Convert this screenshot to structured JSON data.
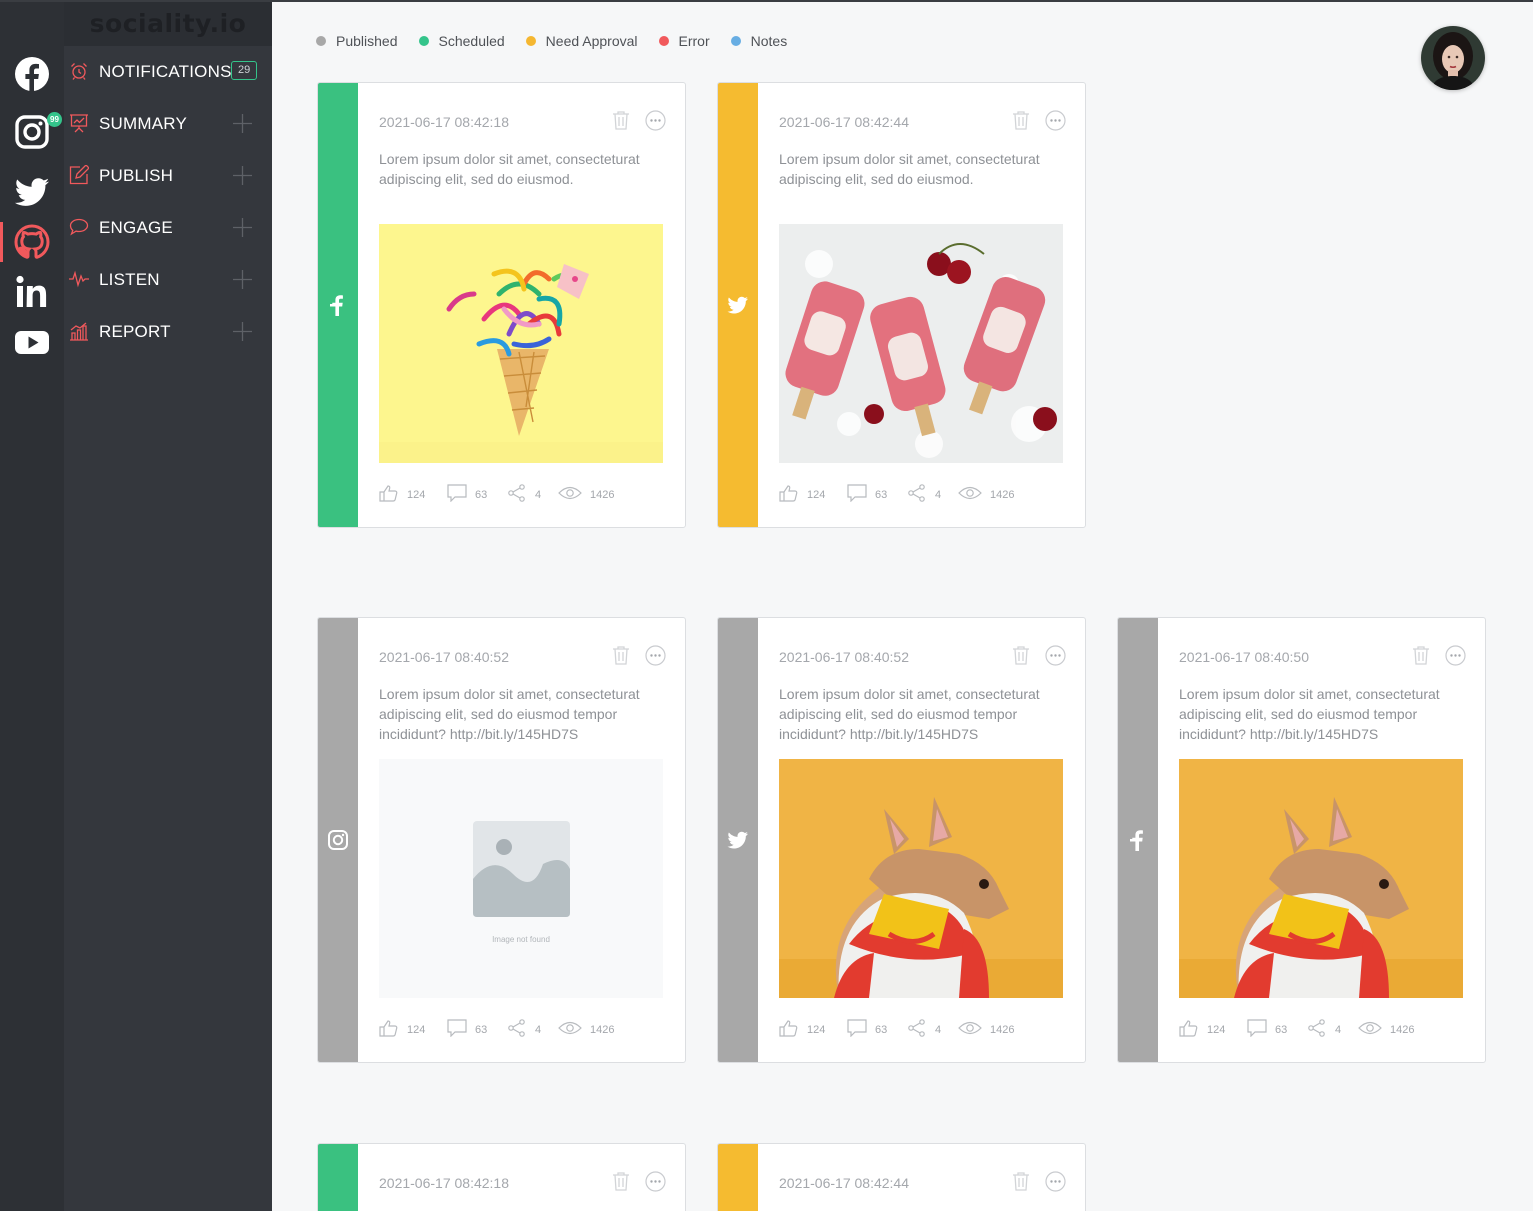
{
  "brand": {
    "logo_text": "sociality.io"
  },
  "social_rail": {
    "items": [
      {
        "name": "facebook",
        "icon": "facebook-icon",
        "active": false,
        "badge": ""
      },
      {
        "name": "instagram",
        "icon": "instagram-icon",
        "active": false,
        "badge": "99"
      },
      {
        "name": "twitter",
        "icon": "twitter-icon",
        "active": false,
        "badge": ""
      },
      {
        "name": "github",
        "icon": "github-icon",
        "active": true,
        "badge": ""
      },
      {
        "name": "linkedin",
        "icon": "linkedin-icon",
        "active": false,
        "badge": ""
      },
      {
        "name": "youtube",
        "icon": "youtube-icon",
        "active": false,
        "badge": ""
      }
    ]
  },
  "menu": {
    "items": [
      {
        "label": "NOTIFICATIONS",
        "icon": "alarm-icon",
        "badge": "29"
      },
      {
        "label": "SUMMARY",
        "icon": "presentation-icon"
      },
      {
        "label": "PUBLISH",
        "icon": "edit-icon"
      },
      {
        "label": "ENGAGE",
        "icon": "chat-icon"
      },
      {
        "label": "LISTEN",
        "icon": "pulse-icon"
      },
      {
        "label": "REPORT",
        "icon": "bar-chart-icon"
      }
    ]
  },
  "legend": [
    {
      "label": "Published",
      "color": "#a8a8a8"
    },
    {
      "label": "Scheduled",
      "color": "#34c48b"
    },
    {
      "label": "Need Approval",
      "color": "#f5b731"
    },
    {
      "label": "Error",
      "color": "#f1595c"
    },
    {
      "label": "Notes",
      "color": "#67ade3"
    }
  ],
  "colors": {
    "published": "#a8a8a8",
    "scheduled": "#3ac180",
    "need_approval": "#f5bb30",
    "accent_red": "#f1595c"
  },
  "posts": [
    {
      "status": "scheduled",
      "network": "facebook",
      "network_icon": "facebook-icon",
      "date": "2021-06-17 08:42:18",
      "text": "Lorem ipsum dolor sit amet, consecteturat adipiscing elit, sed do eiusmod.",
      "media": "ice-cream-confetti-image",
      "stats": {
        "likes": "124",
        "comments": "63",
        "shares": "4",
        "views": "1426"
      }
    },
    {
      "status": "need_approval",
      "network": "twitter",
      "network_icon": "twitter-icon",
      "date": "2021-06-17 08:42:44",
      "text": "Lorem ipsum dolor sit amet, consecteturat adipiscing elit, sed do eiusmod.",
      "media": "popsicles-image",
      "stats": {
        "likes": "124",
        "comments": "63",
        "shares": "4",
        "views": "1426"
      }
    },
    {
      "status": "published",
      "network": "instagram",
      "network_icon": "instagram-icon",
      "date": "2021-06-17 08:40:52",
      "text": "Lorem ipsum dolor sit amet, consecteturat adipiscing elit, sed do eiusmod tempor incididunt? http://bit.ly/145HD7S",
      "media": "image-not-found-placeholder",
      "media_caption": "Image not found",
      "stats": {
        "likes": "124",
        "comments": "63",
        "shares": "4",
        "views": "1426"
      }
    },
    {
      "status": "published",
      "network": "twitter",
      "network_icon": "twitter-icon",
      "date": "2021-06-17 08:40:52",
      "text": "Lorem ipsum dolor sit amet, consecteturat adipiscing elit, sed do eiusmod tempor incididunt? http://bit.ly/145HD7S",
      "media": "dog-in-shirt-image",
      "stats": {
        "likes": "124",
        "comments": "63",
        "shares": "4",
        "views": "1426"
      }
    },
    {
      "status": "published",
      "network": "facebook",
      "network_icon": "facebook-icon",
      "date": "2021-06-17 08:40:50",
      "text": "Lorem ipsum dolor sit amet, consecteturat adipiscing elit, sed do eiusmod tempor incididunt? http://bit.ly/145HD7S",
      "media": "dog-in-shirt-image",
      "stats": {
        "likes": "124",
        "comments": "63",
        "shares": "4",
        "views": "1426"
      }
    },
    {
      "status": "scheduled",
      "network": "facebook",
      "network_icon": "facebook-icon",
      "date": "2021-06-17 08:42:18"
    },
    {
      "status": "need_approval",
      "network": "twitter",
      "network_icon": "twitter-icon",
      "date": "2021-06-17 08:42:44"
    }
  ]
}
